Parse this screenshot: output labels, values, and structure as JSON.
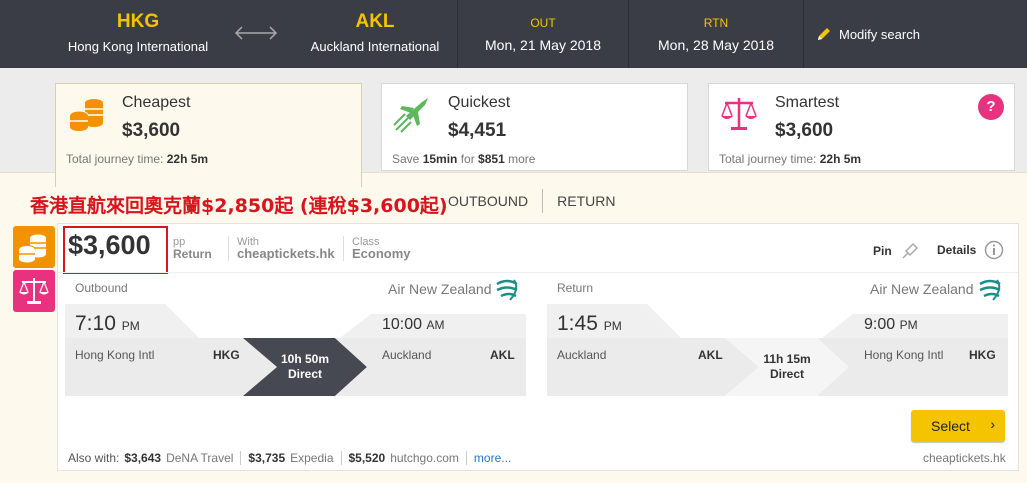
{
  "header": {
    "origin_code": "HKG",
    "origin_name": "Hong Kong International",
    "dest_code": "AKL",
    "dest_name": "Auckland International",
    "out_label": "OUT",
    "out_date": "Mon, 21 May 2018",
    "rtn_label": "RTN",
    "rtn_date": "Mon, 28 May 2018",
    "modify_label": "Modify search",
    "accent": "#f5c400"
  },
  "sort_tabs": [
    {
      "title": "Cheapest",
      "price": "$3,600",
      "sub_prefix": "Total journey time: ",
      "sub_value": "22h 5m",
      "icon": "coins-icon",
      "color": "#f39200"
    },
    {
      "title": "Quickest",
      "price": "$4,451",
      "sub_a": "Save ",
      "sub_b": "15min",
      "sub_c": " for ",
      "sub_d": "$851",
      "sub_e": " more",
      "icon": "plane-icon",
      "color": "#5cb85c"
    },
    {
      "title": "Smartest",
      "price": "$3,600",
      "sub_prefix": "Total journey time: ",
      "sub_value": "22h 5m",
      "icon": "scale-icon",
      "color": "#e8327f",
      "help": "?"
    }
  ],
  "promo_text": "香港直航來回奧克蘭$2,850起 (連稅$3,600起)",
  "direction_tabs": [
    "OUTBOUND",
    "RETURN"
  ],
  "result": {
    "price": "$3,600",
    "pp": "pp",
    "pp_type": "Return",
    "with_label": "With",
    "with_value": "cheaptickets.hk",
    "class_label": "Class",
    "class_value": "Economy",
    "pin_label": "Pin",
    "details_label": "Details",
    "outbound": {
      "label": "Outbound",
      "airline": "Air New Zealand",
      "dep_time": "7:10",
      "dep_ampm": "PM",
      "arr_time": "10:00",
      "arr_ampm": "AM",
      "from_name": "Hong Kong Intl",
      "from_code": "HKG",
      "to_name": "Auckland",
      "to_code": "AKL",
      "duration": "10h 50m",
      "stops": "Direct"
    },
    "return": {
      "label": "Return",
      "airline": "Air New Zealand",
      "dep_time": "1:45",
      "dep_ampm": "PM",
      "arr_time": "9:00",
      "arr_ampm": "PM",
      "from_name": "Auckland",
      "from_code": "AKL",
      "to_name": "Hong Kong Intl",
      "to_code": "HKG",
      "duration": "11h 15m",
      "stops": "Direct"
    },
    "select_label": "Select",
    "select_chevron": "›",
    "also_with_label": "Also with:",
    "also_with": [
      {
        "price": "$3,643",
        "provider": "DeNA Travel"
      },
      {
        "price": "$3,735",
        "provider": "Expedia"
      },
      {
        "price": "$5,520",
        "provider": "hutchgo.com"
      }
    ],
    "more_label": "more...",
    "source": "cheaptickets.hk"
  }
}
